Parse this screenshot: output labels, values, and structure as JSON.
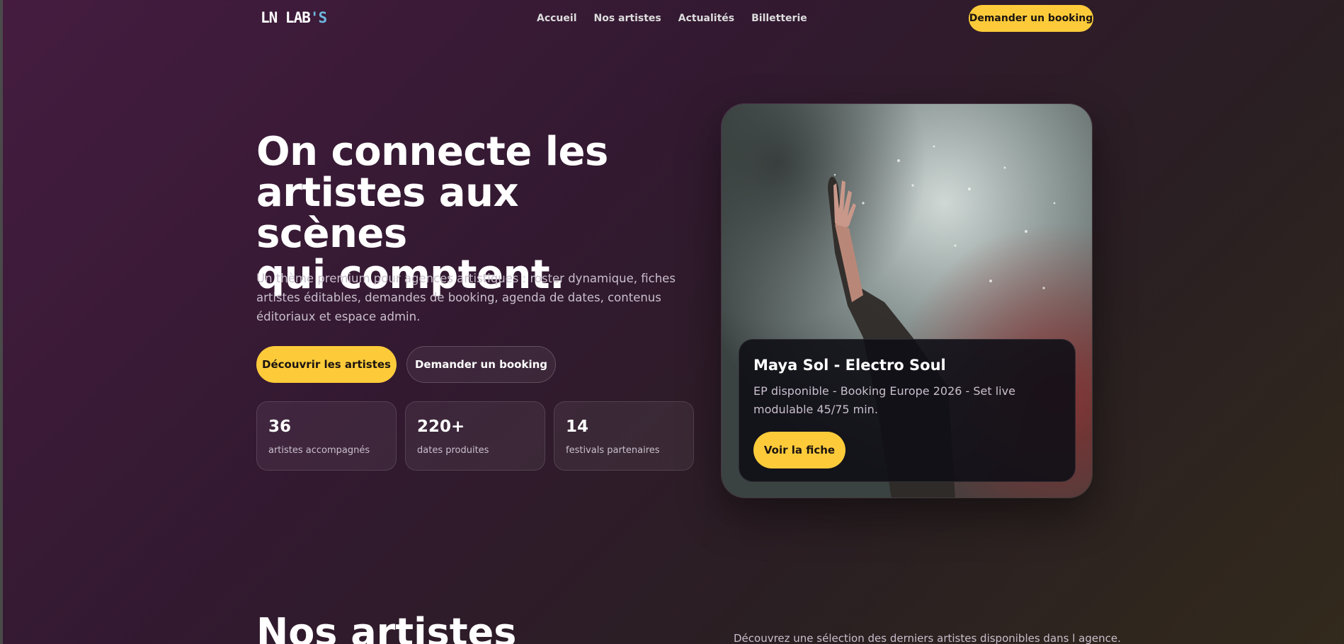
{
  "header": {
    "logo_main": "LN LAB",
    "logo_accent": "'S",
    "nav": [
      "Accueil",
      "Nos artistes",
      "Actualités",
      "Billetterie"
    ],
    "cta": "Demander un booking"
  },
  "hero": {
    "title_lines": [
      "On connecte les",
      "artistes aux scènes",
      "qui comptent."
    ],
    "subtitle": "Un thème premium pour agences artistiques : roster dynamique, fiches artistes éditables, demandes de booking, agenda de dates, contenus éditoriaux et espace admin.",
    "primary_button": "Découvrir les artistes",
    "secondary_button": "Demander un booking",
    "stats": [
      {
        "value": "36",
        "label": "artistes accompagnés"
      },
      {
        "value": "220+",
        "label": "dates produites"
      },
      {
        "value": "14",
        "label": "festivals partenaires"
      }
    ]
  },
  "featured": {
    "title": "Maya Sol - Electro Soul",
    "description": "EP disponible - Booking Europe 2026 - Set live modulable 45/75 min.",
    "button": "Voir la fiche"
  },
  "artists_section": {
    "title": "Nos artistes",
    "description": "Découvrez une sélection des derniers artistes disponibles dans l agence."
  },
  "colors": {
    "accent": "#fdcb3a",
    "logo_accent": "#6fb7df",
    "bg_start": "#451c40",
    "bg_end": "#322a1c"
  }
}
